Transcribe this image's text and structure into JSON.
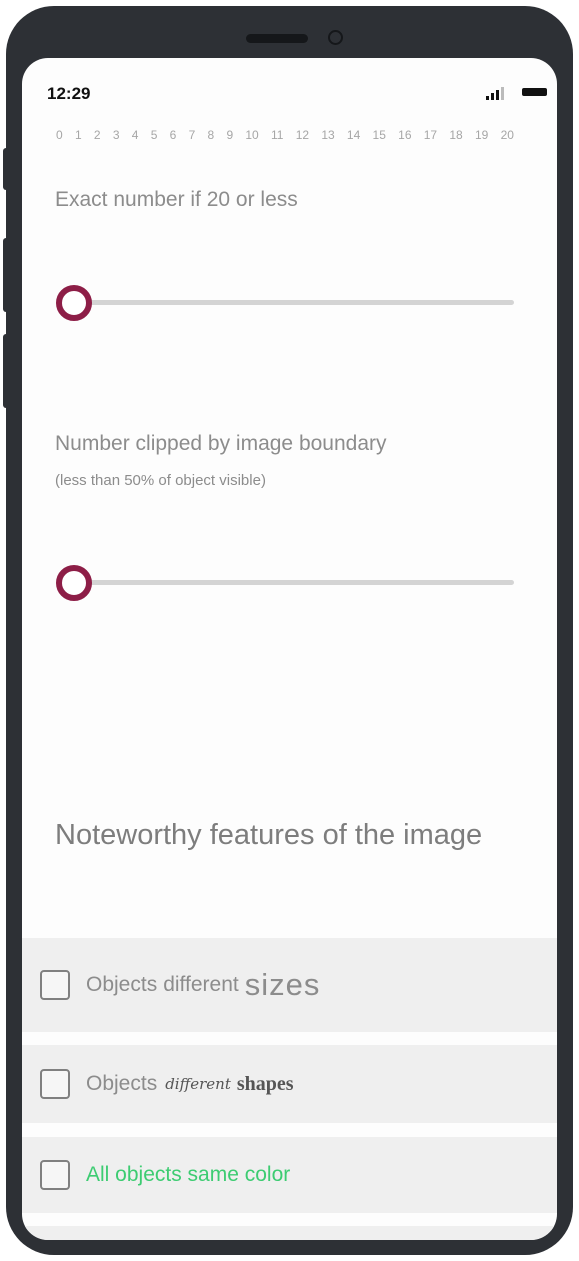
{
  "status_bar": {
    "time": "12:29"
  },
  "scale_ticks": [
    "0",
    "1",
    "2",
    "3",
    "4",
    "5",
    "6",
    "7",
    "8",
    "9",
    "10",
    "11",
    "12",
    "13",
    "14",
    "15",
    "16",
    "17",
    "18",
    "19",
    "20"
  ],
  "slider_exact": {
    "label": "Exact number if 20 or less",
    "value": 0,
    "min": 0,
    "max": 20
  },
  "slider_clipped": {
    "label": "Number clipped by image boundary",
    "sublabel": "(less than 50% of object visible)",
    "value": 0,
    "min": 0,
    "max": 20
  },
  "features": {
    "title": "Noteworthy features of the image",
    "options": [
      {
        "parts": [
          "Objects",
          "different",
          "sizes"
        ],
        "checked": false
      },
      {
        "parts": [
          "Objects",
          "different",
          "shapes"
        ],
        "checked": false
      },
      {
        "parts": [
          "All objects same color"
        ],
        "checked": false
      }
    ]
  },
  "colors": {
    "accent": "#8d1e47",
    "highlight_text": "#3dcc72"
  }
}
